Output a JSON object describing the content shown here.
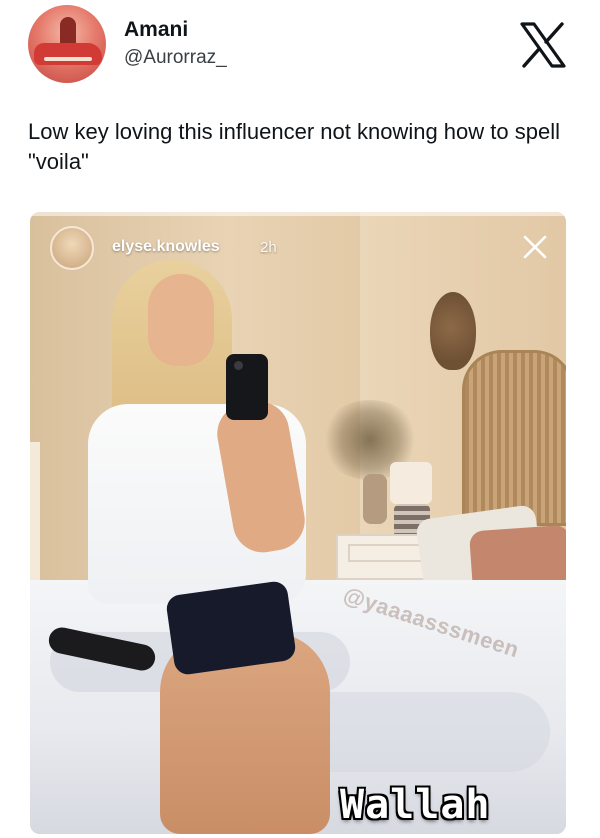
{
  "tweet": {
    "author_name": "Amani",
    "author_handle": "@Aurorraz_",
    "text": "Low key loving this influencer not knowing how to spell \"voila\"",
    "avatar_icon": "profile-photo-woman-red-car",
    "platform_icon": "x-logo-icon"
  },
  "story": {
    "username": "elyse.knowles",
    "time_ago": "2h",
    "close_icon": "close-icon",
    "watermark": "@yaaaasssmeen",
    "caption": "Wallah"
  },
  "colors": {
    "text_primary": "#0f1419",
    "handle_gray": "#3a3f44",
    "caption_text": "#ffffff",
    "caption_outline": "#000000"
  }
}
